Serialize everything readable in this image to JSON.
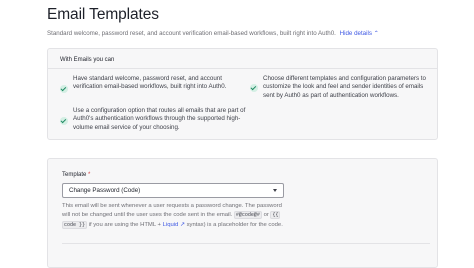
{
  "page": {
    "title": "Email Templates",
    "subtitle": "Standard welcome, password reset, and account verification email-based workflows, built right into Auth0.",
    "hide_details": "Hide details"
  },
  "info_card": {
    "heading": "With Emails you can",
    "features": [
      "Have standard welcome, password reset, and account verification email-based workflows, built right into Auth0.",
      "Use a configuration option that routes all emails that are part of Auth0's authentication workflows through the supported high-volume email service of your choosing.",
      "Choose different templates and configuration parameters to customize the look and feel and sender identities of emails sent by Auth0 as part of authentication workflows."
    ]
  },
  "template_form": {
    "label": "Template",
    "required_mark": "*",
    "selected": "Change Password (Code)",
    "help_part1": "This email will be sent whenever a user requests a password change. The password will not be changed until the user uses the code sent in the email.",
    "code1": "#@code@#",
    "help_or": "or",
    "code2": "{{",
    "code3": "code }}",
    "help_part2": "if you are using the HTML +",
    "liquid_link": "Liquid",
    "help_part3": "syntax) is a placeholder for the code."
  },
  "icons": {
    "check": "check-circle-icon",
    "caret": "chevron-down-icon",
    "external": "external-link-icon"
  },
  "colors": {
    "link": "#3f59e4",
    "check_bg": "#d4efe4",
    "check_mark": "#1f8a63",
    "required": "#d13b3b"
  }
}
